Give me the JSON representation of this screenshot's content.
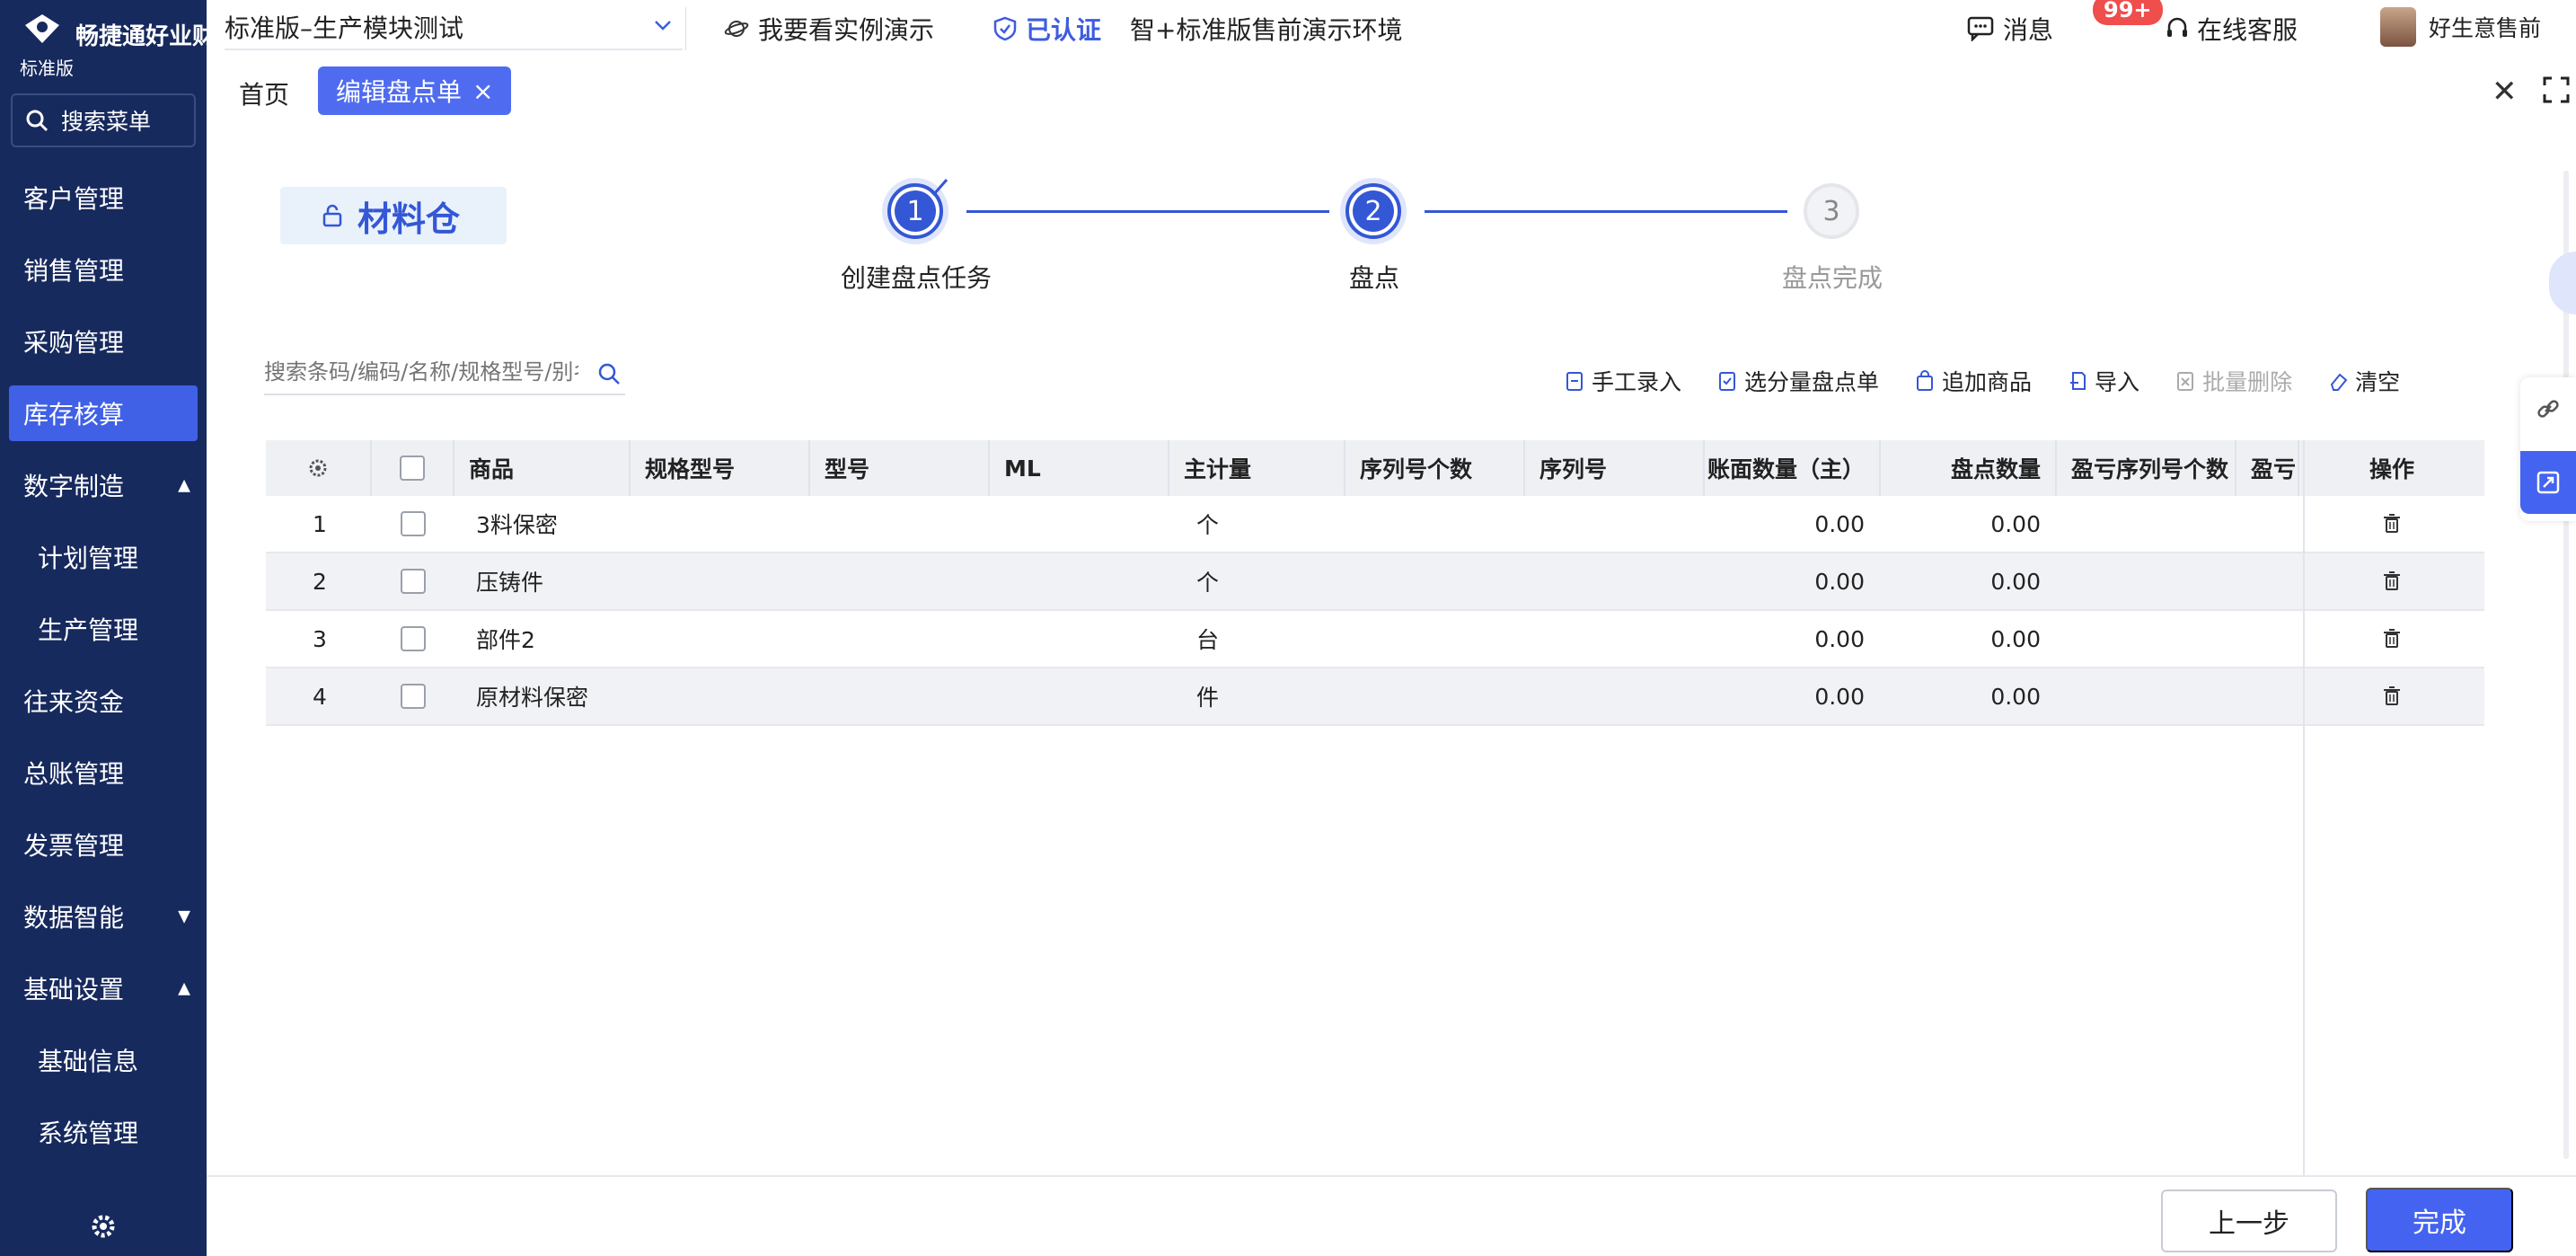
{
  "brand": {
    "name": "畅捷通好业财",
    "edition": "标准版"
  },
  "sidebar": {
    "search_label": "搜索菜单",
    "items": [
      {
        "label": "客户管理",
        "type": "top"
      },
      {
        "label": "销售管理",
        "type": "top"
      },
      {
        "label": "采购管理",
        "type": "top"
      },
      {
        "label": "库存核算",
        "type": "active"
      },
      {
        "label": "数字制造",
        "type": "expanded"
      },
      {
        "label": "计划管理",
        "type": "sub"
      },
      {
        "label": "生产管理",
        "type": "sub"
      },
      {
        "label": "往来资金",
        "type": "top"
      },
      {
        "label": "总账管理",
        "type": "top"
      },
      {
        "label": "发票管理",
        "type": "top"
      },
      {
        "label": "数据智能",
        "type": "collapsed"
      },
      {
        "label": "基础设置",
        "type": "expanded"
      },
      {
        "label": "基础信息",
        "type": "sub"
      },
      {
        "label": "系统管理",
        "type": "sub"
      }
    ]
  },
  "header": {
    "org_name": "标准版–生产模块测试",
    "demo_link": "我要看实例演示",
    "verified": "已认证",
    "environment": "智+标准版售前演示环境",
    "messages": "消息",
    "message_badge": "99+",
    "support": "在线客服",
    "user": "好生意售前"
  },
  "tabs": {
    "home": "首页",
    "active": "编辑盘点单"
  },
  "warehouse": {
    "name": "材料仓"
  },
  "steps": [
    {
      "index": "1",
      "label": "创建盘点任务",
      "state": "done"
    },
    {
      "index": "2",
      "label": "盘点",
      "state": "current"
    },
    {
      "index": "3",
      "label": "盘点完成",
      "state": "pending"
    }
  ],
  "search": {
    "placeholder": "搜索条码/编码/名称/规格型号/别名"
  },
  "toolbar": {
    "manual_entry": "手工录入",
    "select_batch": "选分量盘点单",
    "add_goods": "追加商品",
    "import": "导入",
    "batch_delete": "批量删除",
    "clear": "清空"
  },
  "table": {
    "columns": [
      "商品",
      "规格型号",
      "型号",
      "ML",
      "主计量",
      "序列号个数",
      "序列号",
      "账面数量（主）",
      "盘点数量",
      "盈亏序列号个数",
      "盈亏",
      "操作"
    ],
    "rows": [
      {
        "no": "1",
        "product": "3料保密",
        "unit": "个",
        "book_qty": "0.00",
        "count_qty": "0.00"
      },
      {
        "no": "2",
        "product": "压铸件",
        "unit": "个",
        "book_qty": "0.00",
        "count_qty": "0.00"
      },
      {
        "no": "3",
        "product": "部件2",
        "unit": "台",
        "book_qty": "0.00",
        "count_qty": "0.00"
      },
      {
        "no": "4",
        "product": "原材料保密",
        "unit": "件",
        "book_qty": "0.00",
        "count_qty": "0.00"
      }
    ]
  },
  "footer": {
    "prev": "上一步",
    "done": "完成"
  },
  "colors": {
    "sidebar": "#172a5e",
    "primary": "#4463f0",
    "active_nav": "#4060e6"
  }
}
